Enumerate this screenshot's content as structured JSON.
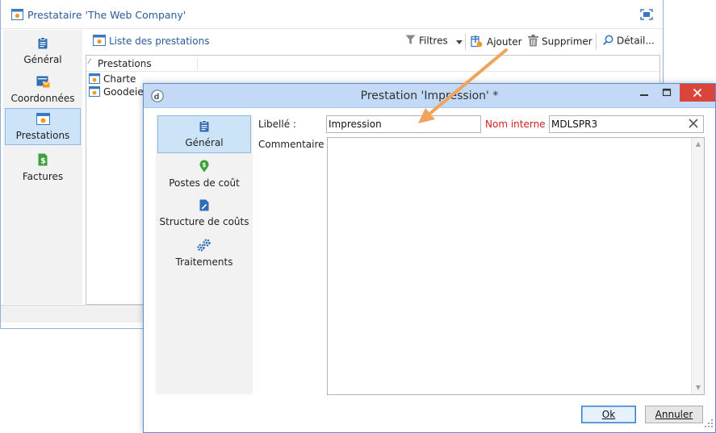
{
  "colors": {
    "accent": "#2a5b98",
    "dialog_titlebar": "#c2daf6",
    "required_label": "#d42020",
    "close_button": "#d9453a",
    "annotation_arrow": "#f0a35a"
  },
  "background_window": {
    "title": "Prestataire 'The Web Company'",
    "sidebar": [
      {
        "label": "Général",
        "icon": "clipboard-icon"
      },
      {
        "label": "Coordonnées",
        "icon": "address-card-icon"
      },
      {
        "label": "Prestations",
        "icon": "service-icon",
        "selected": true
      },
      {
        "label": "Factures",
        "icon": "invoice-icon"
      }
    ],
    "toolbar": {
      "list_label": "Liste des prestations",
      "filters_label": "Filtres",
      "add_label": "Ajouter",
      "delete_label": "Supprimer",
      "detail_label": "Détail..."
    },
    "list": {
      "sort_glyph": "⁄",
      "column_header": "Prestations",
      "rows": [
        "Charte",
        "Goodeies"
      ]
    }
  },
  "dialog": {
    "title": "Prestation 'Impression' *",
    "sidebar": [
      {
        "label": "Général",
        "icon": "clipboard-icon",
        "selected": true
      },
      {
        "label": "Postes de coût",
        "icon": "cost-pin-icon"
      },
      {
        "label": "Structure de coûts",
        "icon": "cost-structure-icon"
      },
      {
        "label": "Traitements",
        "icon": "gears-icon"
      }
    ],
    "form": {
      "libelle_label": "Libellé :",
      "libelle_value": "Impression",
      "internal_name_label": "Nom interne :",
      "internal_name_value": "MDLSPR3",
      "comment_label": "Commentaire :",
      "comment_value": ""
    },
    "buttons": {
      "ok_label": "Ok",
      "cancel_label": "Annuler"
    }
  }
}
